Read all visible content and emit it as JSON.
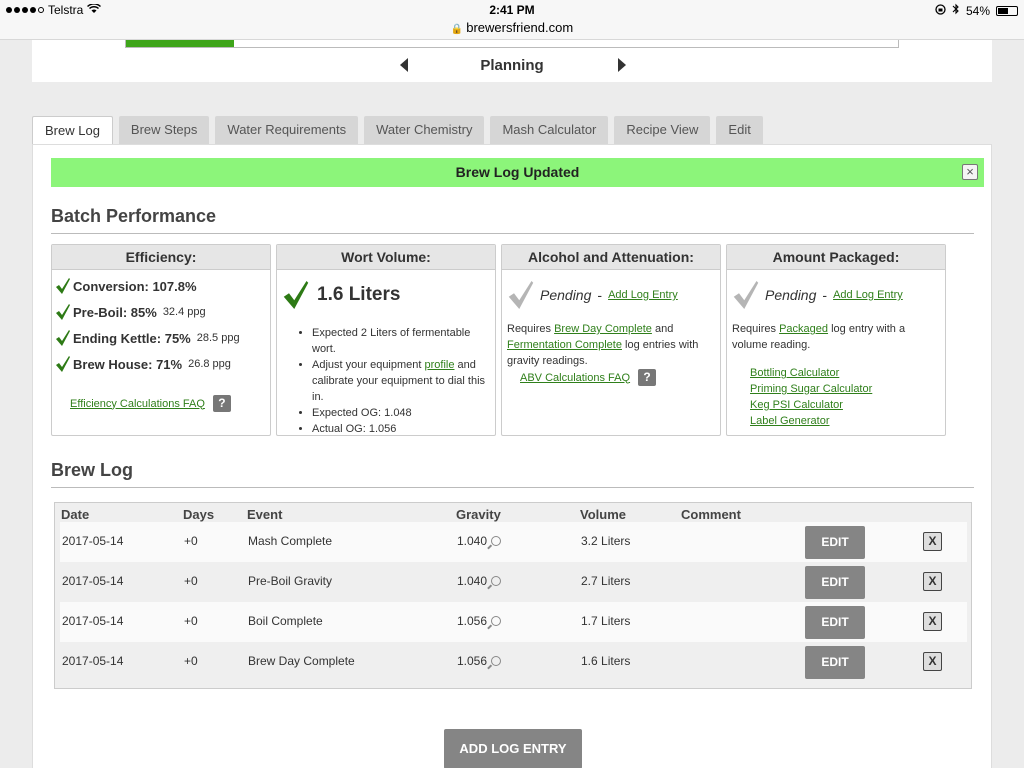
{
  "status": {
    "carrier": "Telstra",
    "time": "2:41 PM",
    "battery": "54%",
    "battery_level": 0.54
  },
  "browser": {
    "url": "brewersfriend.com"
  },
  "progress": {
    "value": 0.14,
    "stage": "Planning"
  },
  "tabs": [
    {
      "label": "Brew Log"
    },
    {
      "label": "Brew Steps"
    },
    {
      "label": "Water Requirements"
    },
    {
      "label": "Water Chemistry"
    },
    {
      "label": "Mash Calculator"
    },
    {
      "label": "Recipe View"
    },
    {
      "label": "Edit"
    }
  ],
  "notice": {
    "text": "Brew Log Updated",
    "close": "×"
  },
  "batch": {
    "title": "Batch Performance"
  },
  "efficiency": {
    "title": "Efficiency:",
    "rows": [
      {
        "label": "Conversion: 107.8%",
        "sub": ""
      },
      {
        "label": "Pre-Boil: 85%",
        "sub": "32.4 ppg"
      },
      {
        "label": "Ending Kettle: 75%",
        "sub": "28.5 ppg"
      },
      {
        "label": "Brew House: 71%",
        "sub": "26.8 ppg"
      }
    ],
    "faq": "Efficiency Calculations FAQ",
    "help": "?"
  },
  "wort": {
    "title": "Wort Volume:",
    "value": "1.6 Liters",
    "items": [
      "Expected 2 Liters of fermentable wort.",
      "Expected OG: 1.048",
      "Actual OG: 1.056"
    ],
    "adjust_pre": "Adjust your equipment",
    "adjust_link": "profile",
    "adjust_post": "and calibrate your equipment to dial this in."
  },
  "alcohol": {
    "title": "Alcohol and Attenuation:",
    "pending": "Pending",
    "dash": "-",
    "add_link": "Add Log Entry",
    "req_pre": "Requires",
    "req_link1": "Brew Day Complete",
    "req_and": "and",
    "req_link2": "Fermentation Complete",
    "req_post": "log entries with gravity readings.",
    "faq": "ABV Calculations FAQ",
    "help": "?"
  },
  "packaged": {
    "title": "Amount Packaged:",
    "pending": "Pending",
    "dash": "-",
    "add_link": "Add Log Entry",
    "req_pre": "Requires",
    "req_link": "Packaged",
    "req_post": "log entry with a volume reading.",
    "tools": [
      "Bottling Calculator",
      "Priming Sugar Calculator",
      "Keg PSI Calculator",
      "Label Generator"
    ]
  },
  "log": {
    "title": "Brew Log",
    "headers": {
      "date": "Date",
      "days": "Days",
      "event": "Event",
      "gravity": "Gravity",
      "volume": "Volume",
      "comment": "Comment"
    },
    "rows": [
      {
        "date": "2017-05-14",
        "days": "+0",
        "event": "Mash Complete",
        "gravity": "1.040",
        "volume": "3.2 Liters",
        "comment": ""
      },
      {
        "date": "2017-05-14",
        "days": "+0",
        "event": "Pre-Boil Gravity",
        "gravity": "1.040",
        "volume": "2.7 Liters",
        "comment": ""
      },
      {
        "date": "2017-05-14",
        "days": "+0",
        "event": "Boil Complete",
        "gravity": "1.056",
        "volume": "1.7 Liters",
        "comment": ""
      },
      {
        "date": "2017-05-14",
        "days": "+0",
        "event": "Brew Day Complete",
        "gravity": "1.056",
        "volume": "1.6 Liters",
        "comment": ""
      }
    ],
    "edit": "EDIT",
    "delete": "X",
    "add": "ADD LOG ENTRY"
  }
}
